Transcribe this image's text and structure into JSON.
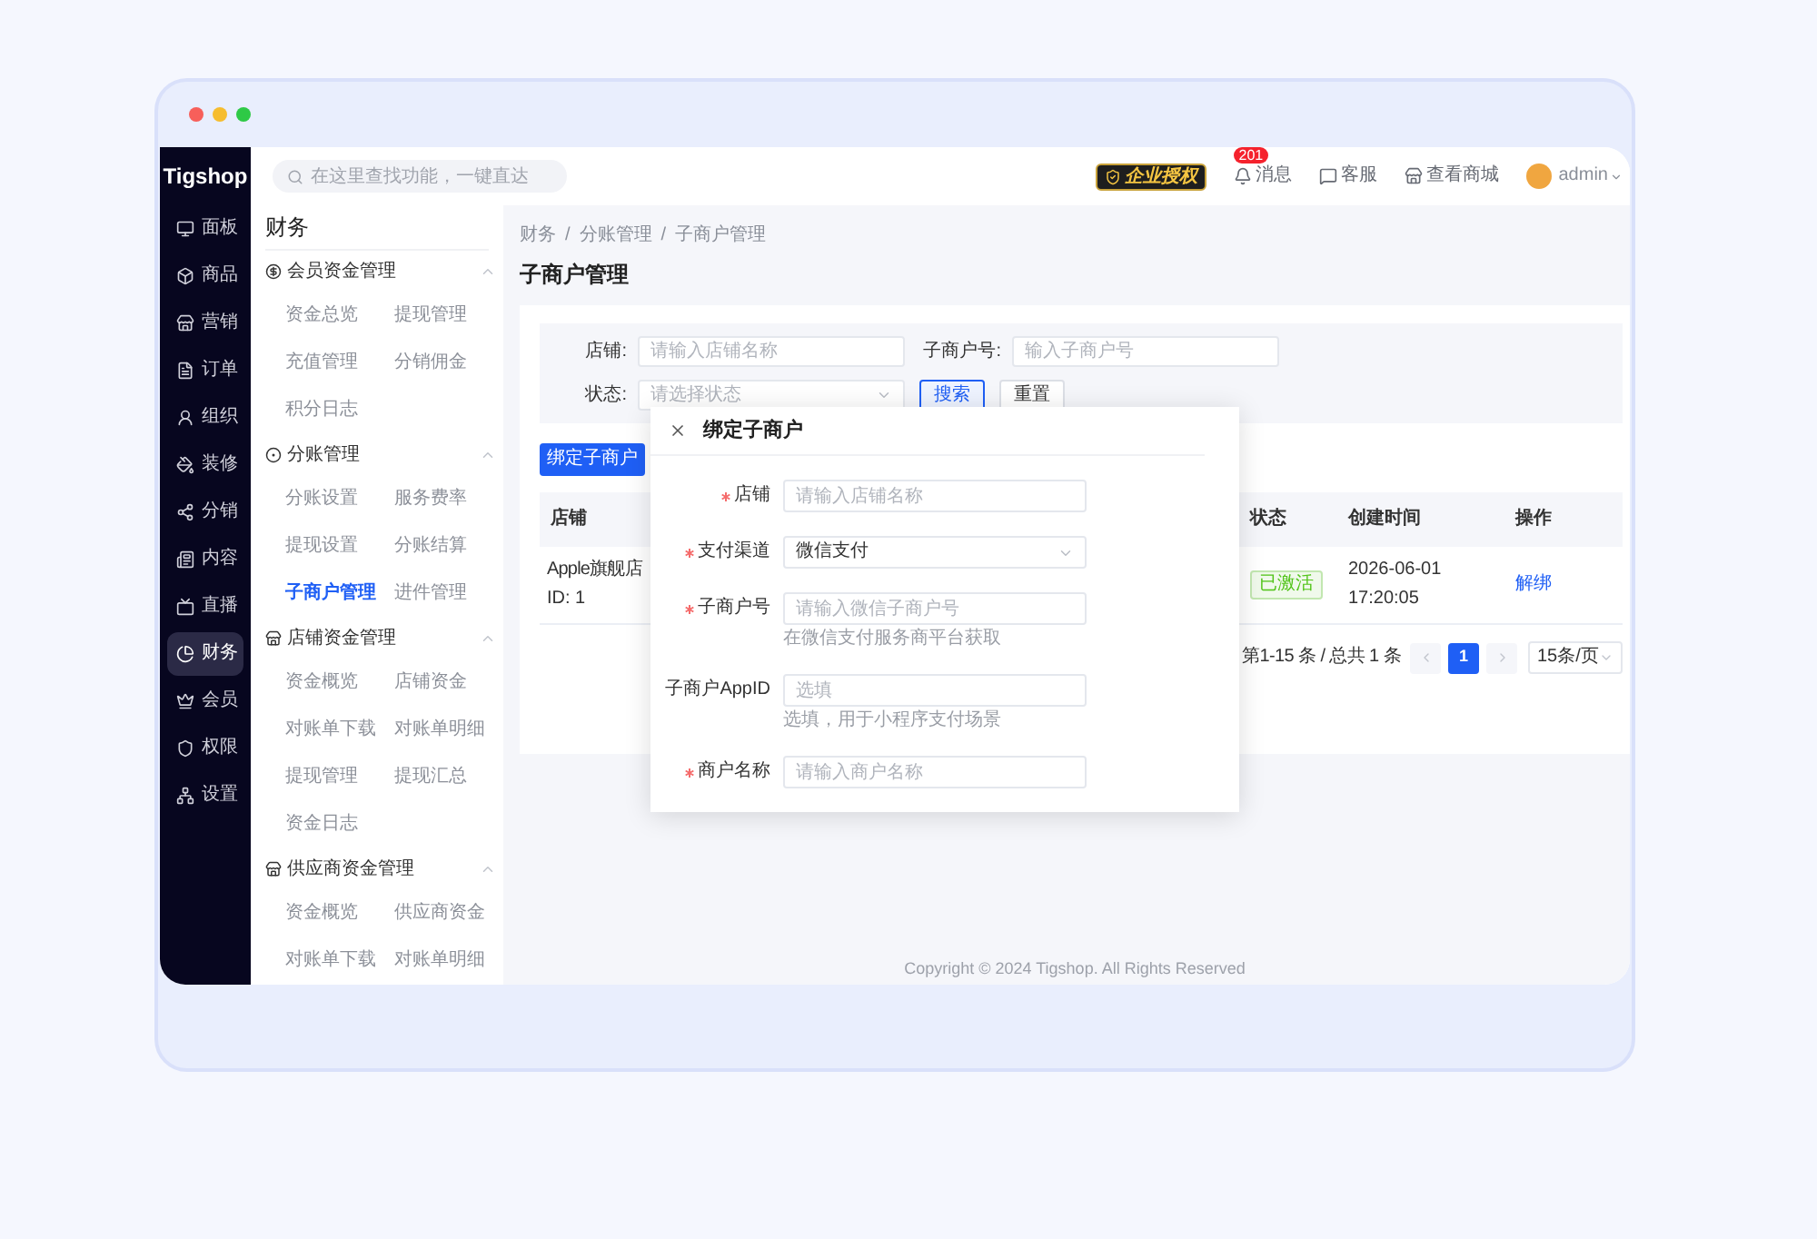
{
  "window": {
    "dots": [
      {
        "color": "#f75f5a"
      },
      {
        "color": "#f6bd2f"
      },
      {
        "color": "#2ec946"
      }
    ]
  },
  "logo": "Tigshop",
  "search": {
    "placeholder": "在这里查找功能，一键直达"
  },
  "header": {
    "license_badge": "企业授权",
    "actions": [
      {
        "kind": "messages",
        "label": "消息",
        "badge": "201"
      },
      {
        "kind": "service",
        "label": "客服"
      },
      {
        "kind": "store",
        "label": "查看商城"
      }
    ],
    "user": "admin"
  },
  "nav": [
    {
      "label": "面板",
      "selected": false
    },
    {
      "label": "商品",
      "selected": false
    },
    {
      "label": "营销",
      "selected": false
    },
    {
      "label": "订单",
      "selected": false
    },
    {
      "label": "组织",
      "selected": false
    },
    {
      "label": "装修",
      "selected": false
    },
    {
      "label": "分销",
      "selected": false
    },
    {
      "label": "内容",
      "selected": false
    },
    {
      "label": "直播",
      "selected": false
    },
    {
      "label": "财务",
      "selected": true
    },
    {
      "label": "会员",
      "selected": false
    },
    {
      "label": "权限",
      "selected": false
    },
    {
      "label": "设置",
      "selected": false
    }
  ],
  "subnav": {
    "title": "财务",
    "groups": [
      {
        "title": "会员资金管理",
        "expanded": true,
        "items": [
          {
            "label": "资金总览",
            "selected": false
          },
          {
            "label": "提现管理",
            "selected": false
          },
          {
            "label": "充值管理",
            "selected": false
          },
          {
            "label": "分销佣金",
            "selected": false
          },
          {
            "label": "积分日志",
            "selected": false
          }
        ]
      },
      {
        "title": "分账管理",
        "expanded": true,
        "items": [
          {
            "label": "分账设置",
            "selected": false
          },
          {
            "label": "服务费率",
            "selected": false
          },
          {
            "label": "提现设置",
            "selected": false
          },
          {
            "label": "分账结算",
            "selected": false
          },
          {
            "label": "子商户管理",
            "selected": true
          },
          {
            "label": "进件管理",
            "selected": false
          }
        ]
      },
      {
        "title": "店铺资金管理",
        "expanded": true,
        "items": [
          {
            "label": "资金概览",
            "selected": false
          },
          {
            "label": "店铺资金",
            "selected": false
          },
          {
            "label": "对账单下载",
            "selected": false
          },
          {
            "label": "对账单明细",
            "selected": false
          },
          {
            "label": "提现管理",
            "selected": false
          },
          {
            "label": "提现汇总",
            "selected": false
          },
          {
            "label": "资金日志",
            "selected": false
          }
        ]
      },
      {
        "title": "供应商资金管理",
        "expanded": true,
        "items": [
          {
            "label": "资金概览",
            "selected": false
          },
          {
            "label": "供应商资金",
            "selected": false
          },
          {
            "label": "对账单下载",
            "selected": false
          },
          {
            "label": "对账单明细",
            "selected": false
          }
        ]
      }
    ]
  },
  "breadcrumb": {
    "items": [
      "财务",
      "分账管理",
      "子商户管理"
    ],
    "separator": "/"
  },
  "page_title": "子商户管理",
  "filters": {
    "fields": [
      {
        "label": "店铺:",
        "kind": "input",
        "placeholder": "请输入店铺名称"
      },
      {
        "label": "子商户号:",
        "kind": "input",
        "placeholder": "输入子商户号"
      },
      {
        "label": "状态:",
        "kind": "select",
        "placeholder": "请选择状态"
      }
    ],
    "buttons": [
      {
        "label": "搜索",
        "kind": "primary"
      },
      {
        "label": "重置",
        "kind": "default"
      }
    ]
  },
  "add_button": "绑定子商户",
  "table": {
    "columns": [
      "店铺",
      "状态",
      "创建时间",
      "操作"
    ],
    "rows": [
      {
        "store": "Apple旗舰店",
        "store_id": "ID: 1",
        "status": {
          "label": "已激活",
          "kind": "success"
        },
        "created_date": "2026-06-01",
        "created_time": "17:20:05",
        "action": "解绑"
      }
    ]
  },
  "pagination": {
    "summary": "第1-15 条 / 总共 1 条",
    "pages": [
      {
        "label": "1",
        "selected": true
      }
    ],
    "page_size": "15条/页"
  },
  "modal": {
    "title": "绑定子商户",
    "fields": [
      {
        "label": "店铺",
        "required": true,
        "kind": "input",
        "placeholder": "请输入店铺名称"
      },
      {
        "label": "支付渠道",
        "required": true,
        "kind": "select",
        "value": "微信支付"
      },
      {
        "label": "子商户号",
        "required": true,
        "kind": "input",
        "placeholder": "请输入微信子商户号",
        "help": "在微信支付服务商平台获取"
      },
      {
        "label": "子商户AppID",
        "required": false,
        "kind": "input",
        "placeholder": "选填",
        "help": "选填，用于小程序支付场景"
      },
      {
        "label": "商户名称",
        "required": true,
        "kind": "input",
        "placeholder": "请输入商户名称"
      }
    ]
  },
  "footer": "Copyright © 2024 Tigshop. All Rights Reserved"
}
